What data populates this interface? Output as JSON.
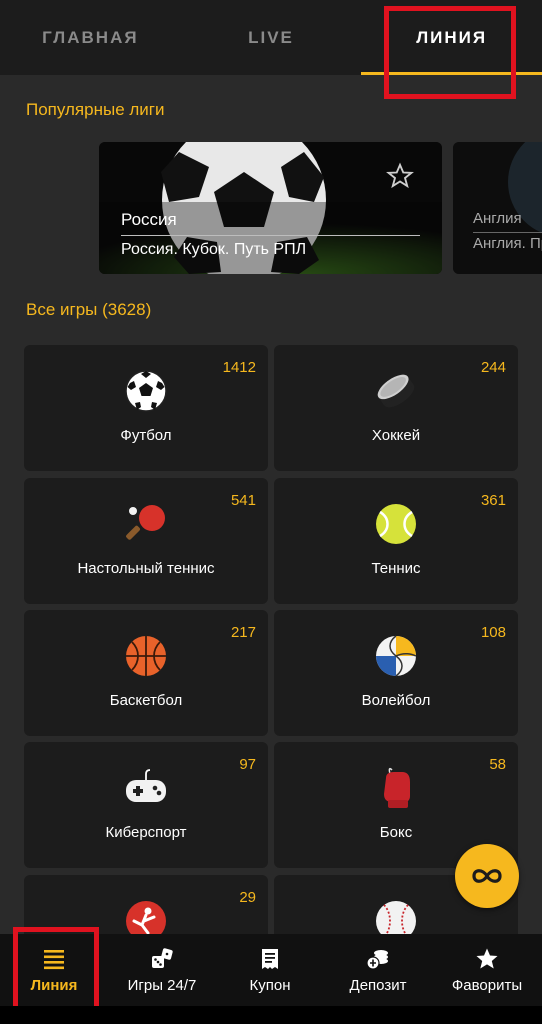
{
  "tabs": [
    {
      "label": "ГЛАВНАЯ",
      "active": false
    },
    {
      "label": "LIVE",
      "active": false
    },
    {
      "label": "ЛИНИЯ",
      "active": true
    }
  ],
  "popular": {
    "title": "Популярные лиги",
    "cards": [
      {
        "country": "Россия",
        "tournament": "Россия. Кубок. Путь РПЛ"
      },
      {
        "country": "Англия",
        "tournament": "Англия. Премьер-лига"
      }
    ]
  },
  "all_games": {
    "title": "Все игры (3628)",
    "sports": [
      {
        "name": "Футбол",
        "count": "1412",
        "icon": "soccer-ball-icon"
      },
      {
        "name": "Хоккей",
        "count": "244",
        "icon": "hockey-puck-icon"
      },
      {
        "name": "Настольный теннис",
        "count": "541",
        "icon": "table-tennis-icon"
      },
      {
        "name": "Теннис",
        "count": "361",
        "icon": "tennis-ball-icon"
      },
      {
        "name": "Баскетбол",
        "count": "217",
        "icon": "basketball-icon"
      },
      {
        "name": "Волейбол",
        "count": "108",
        "icon": "volleyball-icon"
      },
      {
        "name": "Киберспорт",
        "count": "97",
        "icon": "gamepad-icon"
      },
      {
        "name": "Бокс",
        "count": "58",
        "icon": "boxing-glove-icon"
      },
      {
        "name": "",
        "count": "29",
        "icon": "martial-arts-icon"
      },
      {
        "name": "",
        "count": "",
        "icon": "baseball-icon"
      }
    ]
  },
  "bottom_nav": [
    {
      "label": "Линия",
      "icon": "list-icon",
      "active": true
    },
    {
      "label": "Игры 24/7",
      "icon": "dice-icon",
      "active": false
    },
    {
      "label": "Купон",
      "icon": "coupon-icon",
      "active": false
    },
    {
      "label": "Депозит",
      "icon": "coins-icon",
      "active": false
    },
    {
      "label": "Фавориты",
      "icon": "star-icon",
      "active": false
    }
  ],
  "colors": {
    "accent": "#f6b81e",
    "background": "#2a2a2a",
    "card": "#1c1c1c",
    "highlight": "#e0121f"
  }
}
